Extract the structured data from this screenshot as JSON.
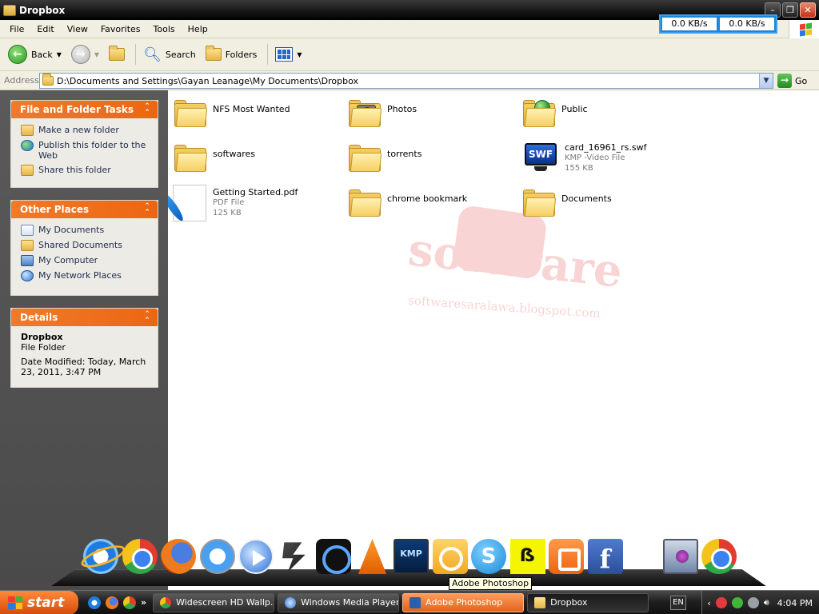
{
  "window": {
    "title": "Dropbox"
  },
  "net_meter": {
    "download": "0.0 KB/s",
    "upload": "0.0 KB/s",
    "color": "#1e86d8"
  },
  "menu": [
    "File",
    "Edit",
    "View",
    "Favorites",
    "Tools",
    "Help"
  ],
  "toolbar": {
    "back_label": "Back",
    "search_label": "Search",
    "folders_label": "Folders"
  },
  "address": {
    "label": "Address",
    "value": "D:\\Documents and Settings\\Gayan Leanage\\My Documents\\Dropbox",
    "go_label": "Go"
  },
  "tasks_panel": {
    "title": "File and Folder Tasks",
    "items": [
      "Make a new folder",
      "Publish this folder to the Web",
      "Share this folder"
    ]
  },
  "places_panel": {
    "title": "Other Places",
    "items": [
      "My Documents",
      "Shared Documents",
      "My Computer",
      "My Network Places"
    ]
  },
  "details_panel": {
    "title": "Details",
    "name": "Dropbox",
    "type": "File Folder",
    "modified": "Date Modified: Today, March 23, 2011, 3:47 PM"
  },
  "files": [
    {
      "name": "NFS Most Wanted",
      "kind": "folder"
    },
    {
      "name": "Photos",
      "kind": "folder-photos"
    },
    {
      "name": "Public",
      "kind": "folder-public"
    },
    {
      "name": "softwares",
      "kind": "folder"
    },
    {
      "name": "torrents",
      "kind": "folder"
    },
    {
      "name": "card_16961_rs.swf",
      "kind": "swf",
      "type": "KMP -Video File",
      "size": "155 KB"
    },
    {
      "name": "Getting Started.pdf",
      "kind": "pdf",
      "type": "PDF File",
      "size": "125 KB"
    },
    {
      "name": "chrome bookmark",
      "kind": "folder"
    },
    {
      "name": "Documents",
      "kind": "folder"
    }
  ],
  "watermark": {
    "text": "software",
    "url": "softwaresaralawa.blogspot.com"
  },
  "dock": {
    "icons": [
      "internet-explorer-icon",
      "chrome-icon",
      "firefox-icon",
      "safari-icon",
      "windows-media-player-icon",
      "winamp-icon",
      "zune-icon",
      "vlc-icon",
      "kmp-icon",
      "outlook-icon",
      "skype-icon",
      "yellow-app-icon",
      "blogger-icon",
      "facebook-icon",
      "media-center-icon",
      "chrome-icon"
    ],
    "kmp_text": "KMP",
    "tooltip": "Adobe Photoshop"
  },
  "taskbar": {
    "start_label": "start",
    "tasks": [
      {
        "label": "Widescreen HD Wallp...",
        "icon": "chrome-icon"
      },
      {
        "label": "Windows Media Player",
        "icon": "wmp-icon"
      },
      {
        "label": "Adobe Photoshop",
        "icon": "photoshop-icon"
      },
      {
        "label": "Dropbox",
        "icon": "folder-icon"
      }
    ],
    "lang": "EN",
    "clock": "4:04 PM"
  }
}
